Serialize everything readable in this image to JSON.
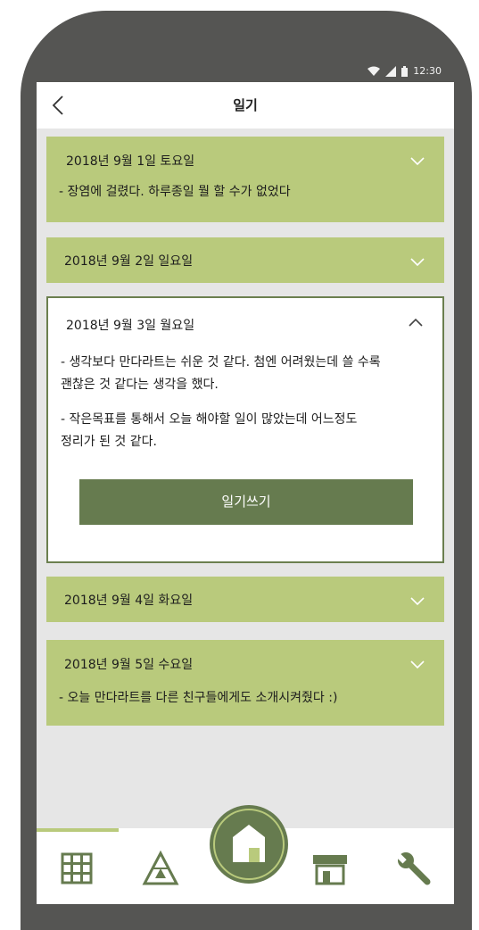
{
  "status_bar": {
    "time": "12:30"
  },
  "header": {
    "title": "일기"
  },
  "entries": [
    {
      "date": "2018년 9월 1일 토요일",
      "expanded": false,
      "text": "- 장염에 걸렸다. 하루종일 뭘 할 수가 없었다"
    },
    {
      "date": "2018년 9월 2일 일요일",
      "expanded": false
    },
    {
      "date": "2018년 9월 3일 월요일",
      "expanded": true,
      "paragraph1_line1": "- 생각보다 만다라트는 쉬운 것 같다. 첨엔 어려웠는데 쓸 수록",
      "paragraph1_line2": "괜찮은 것 같다는 생각을 했다.",
      "paragraph2_line1": "- 작은목표를 통해서 오늘 해야할 일이 많았는데 어느정도",
      "paragraph2_line2": "정리가 된 것 같다.",
      "write_button": "일기쓰기"
    },
    {
      "date": "2018년 9월 4일 화요일",
      "expanded": false
    },
    {
      "date": "2018년 9월 5일 수요일",
      "expanded": false,
      "text": "- 오늘 만다라트를 다른 친구들에게도 소개시켜줬다 :)"
    }
  ],
  "colors": {
    "card_background": "#b9ca7c",
    "accent_dark": "#667b4f",
    "frame": "#555553",
    "page_background": "#e6e6e6"
  },
  "nav": {
    "items": [
      "grid-icon",
      "triangle-icon",
      "home-icon",
      "store-icon",
      "wrench-icon"
    ],
    "active": "grid-icon"
  }
}
